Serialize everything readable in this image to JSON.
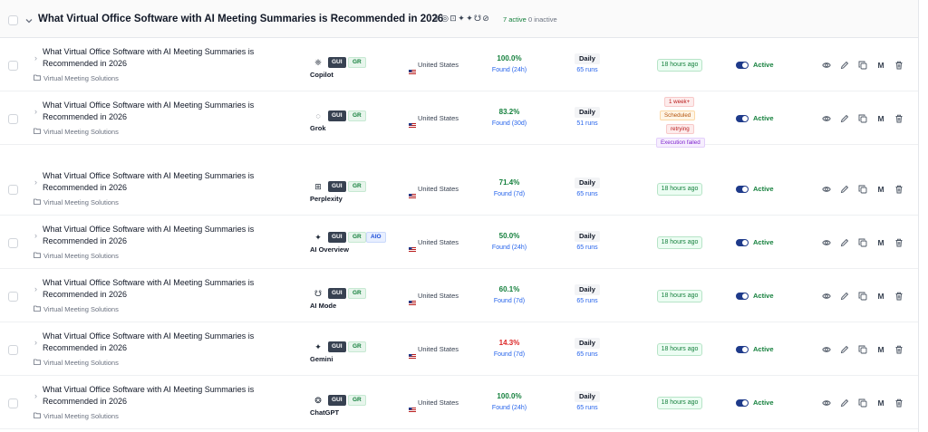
{
  "group": {
    "title": "What Virtual Office Software with AI Meeting Summaries is Recommended in 2026",
    "engine_icons": [
      "❈",
      "◎",
      "⊡",
      "✦",
      "✦",
      "☋",
      "⊘"
    ],
    "active_count": "7 active",
    "inactive_count": "0 inactive"
  },
  "rows": [
    {
      "title": "What Virtual Office Software with AI Meeting Summaries is Recommended in 2026",
      "folder": "Virtual Meeting Solutions",
      "engine_icon": "copilot-icon",
      "engine_glyph": "❈",
      "engine": "Copilot",
      "badges": [
        "GUI",
        "GR"
      ],
      "country": "United States",
      "rate": "100.0%",
      "rate_color": "#15803d",
      "found": "Found (24h)",
      "frequency": "Daily",
      "runs": "65 runs",
      "last_run": "18 hours ago",
      "status_badges": [],
      "toggle_label": "Active"
    },
    {
      "title": "What Virtual Office Software with AI Meeting Summaries is Recommended in 2026",
      "folder": "Virtual Meeting Solutions",
      "engine_icon": "grok-icon",
      "engine_glyph": "◌",
      "engine": "Grok",
      "badges": [
        "GUI",
        "GR"
      ],
      "country": "United States",
      "rate": "83.2%",
      "rate_color": "#15803d",
      "found": "Found (30d)",
      "frequency": "Daily",
      "runs": "51 runs",
      "last_run": "",
      "status_badges": [
        "1 week+",
        "Scheduled",
        "retrying",
        "Execution failed"
      ],
      "toggle_label": "Active"
    },
    {
      "title": "What Virtual Office Software with AI Meeting Summaries is Recommended in 2026",
      "folder": "Virtual Meeting Solutions",
      "engine_icon": "perplexity-icon",
      "engine_glyph": "⊞",
      "engine": "Perplexity",
      "badges": [
        "GUI",
        "GR"
      ],
      "country": "United States",
      "rate": "71.4%",
      "rate_color": "#15803d",
      "found": "Found (7d)",
      "frequency": "Daily",
      "runs": "65 runs",
      "last_run": "18 hours ago",
      "status_badges": [],
      "toggle_label": "Active"
    },
    {
      "title": "What Virtual Office Software with AI Meeting Summaries is Recommended in 2026",
      "folder": "Virtual Meeting Solutions",
      "engine_icon": "ai-overview-icon",
      "engine_glyph": "✦",
      "engine": "AI Overview",
      "badges": [
        "GUI",
        "GR",
        "AIO"
      ],
      "country": "United States",
      "rate": "50.0%",
      "rate_color": "#15803d",
      "found": "Found (24h)",
      "frequency": "Daily",
      "runs": "65 runs",
      "last_run": "18 hours ago",
      "status_badges": [],
      "toggle_label": "Active"
    },
    {
      "title": "What Virtual Office Software with AI Meeting Summaries is Recommended in 2026",
      "folder": "Virtual Meeting Solutions",
      "engine_icon": "ai-mode-icon",
      "engine_glyph": "☋",
      "engine": "AI Mode",
      "badges": [
        "GUI",
        "GR"
      ],
      "country": "United States",
      "rate": "60.1%",
      "rate_color": "#15803d",
      "found": "Found (7d)",
      "frequency": "Daily",
      "runs": "65 runs",
      "last_run": "18 hours ago",
      "status_badges": [],
      "toggle_label": "Active"
    },
    {
      "title": "What Virtual Office Software with AI Meeting Summaries is Recommended in 2026",
      "folder": "Virtual Meeting Solutions",
      "engine_icon": "gemini-icon",
      "engine_glyph": "✦",
      "engine": "Gemini",
      "badges": [
        "GUI",
        "GR"
      ],
      "country": "United States",
      "rate": "14.3%",
      "rate_color": "#dc2626",
      "found": "Found (7d)",
      "frequency": "Daily",
      "runs": "65 runs",
      "last_run": "18 hours ago",
      "status_badges": [],
      "toggle_label": "Active"
    },
    {
      "title": "What Virtual Office Software with AI Meeting Summaries is Recommended in 2026",
      "folder": "Virtual Meeting Solutions",
      "engine_icon": "chatgpt-icon",
      "engine_glyph": "❂",
      "engine": "ChatGPT",
      "badges": [
        "GUI",
        "GR"
      ],
      "country": "United States",
      "rate": "100.0%",
      "rate_color": "#15803d",
      "found": "Found (24h)",
      "frequency": "Daily",
      "runs": "65 runs",
      "last_run": "18 hours ago",
      "status_badges": [],
      "toggle_label": "Active"
    }
  ],
  "actions": {
    "view_icon": "eye-icon",
    "edit_icon": "pencil-icon",
    "copy_icon": "copy-icon",
    "m_label": "M",
    "delete_icon": "trash-icon"
  }
}
